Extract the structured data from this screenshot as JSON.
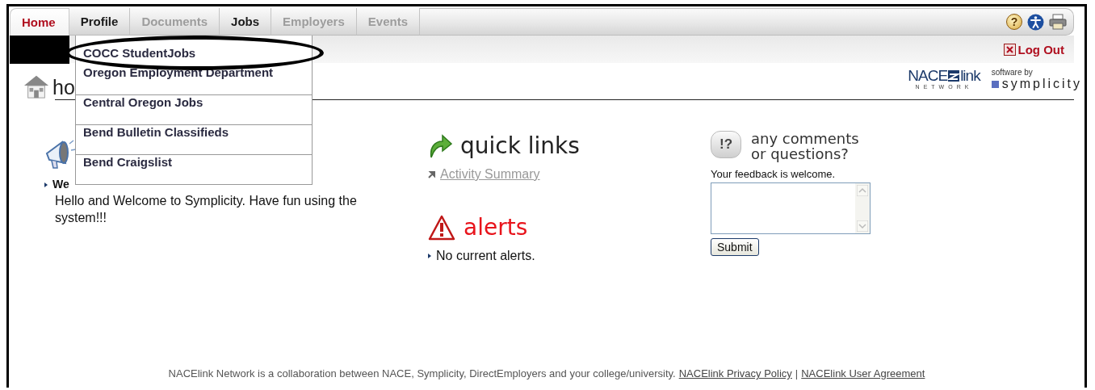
{
  "tabs": [
    {
      "label": "Home",
      "selected": true,
      "disabled": false
    },
    {
      "label": "Profile",
      "selected": false,
      "disabled": false
    },
    {
      "label": "Documents",
      "selected": false,
      "disabled": true
    },
    {
      "label": "Jobs",
      "selected": false,
      "disabled": false
    },
    {
      "label": "Employers",
      "selected": false,
      "disabled": true
    },
    {
      "label": "Events",
      "selected": false,
      "disabled": true
    }
  ],
  "help_glyph": "?",
  "logout": "Log Out",
  "branding": {
    "logo_left": "NACE",
    "logo_right": "link",
    "logo_tagline": "NETWORK",
    "vendor_caption": "software by",
    "vendor_name": "symplicity"
  },
  "page_heading": "ho",
  "dropdown": {
    "items": [
      {
        "label": "COCC StudentJobs",
        "circled": true
      },
      {
        "label": "Oregon Employment Department",
        "circled": false
      },
      {
        "label": "Central Oregon Jobs",
        "circled": false
      },
      {
        "label": "Bend Bulletin Classifieds",
        "circled": false
      },
      {
        "label": "Bend Craigslist",
        "circled": false
      }
    ]
  },
  "announcements": {
    "item_title": "We",
    "body": "Hello and Welcome to Symplicity. Have fun using the system!!!"
  },
  "quick_links": {
    "title": "quick links",
    "links": [
      "Activity Summary"
    ]
  },
  "alerts": {
    "title": "alerts",
    "items": [
      "No current alerts."
    ]
  },
  "feedback": {
    "icon_text": "!?",
    "title_line_1": "any comments",
    "title_line_2": "or questions?",
    "prompt": "Your feedback is welcome.",
    "button": "Submit"
  },
  "footer": {
    "text": "NACElink Network is a collaboration between NACE, Symplicity, DirectEmployers and your college/university.",
    "links": [
      "NACElink Privacy Policy",
      "NACElink User Agreement"
    ],
    "separator": "|"
  }
}
